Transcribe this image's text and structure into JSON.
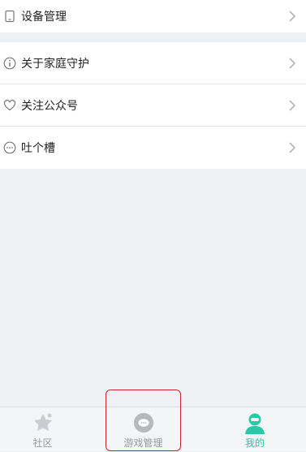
{
  "menu": {
    "items": [
      {
        "label": "设备管理",
        "icon": "device-icon"
      },
      {
        "label": "关于家庭守护",
        "icon": "info-icon"
      },
      {
        "label": "关注公众号",
        "icon": "heart-icon"
      },
      {
        "label": "吐个槽",
        "icon": "chat-bubble-icon"
      }
    ]
  },
  "tabbar": {
    "tabs": [
      {
        "label": "社区",
        "icon": "community-icon"
      },
      {
        "label": "游戏管理",
        "icon": "game-management-icon"
      },
      {
        "label": "我的",
        "icon": "profile-icon"
      }
    ]
  },
  "colors": {
    "accent": "#29c9a8",
    "highlight": "#c2272d"
  }
}
